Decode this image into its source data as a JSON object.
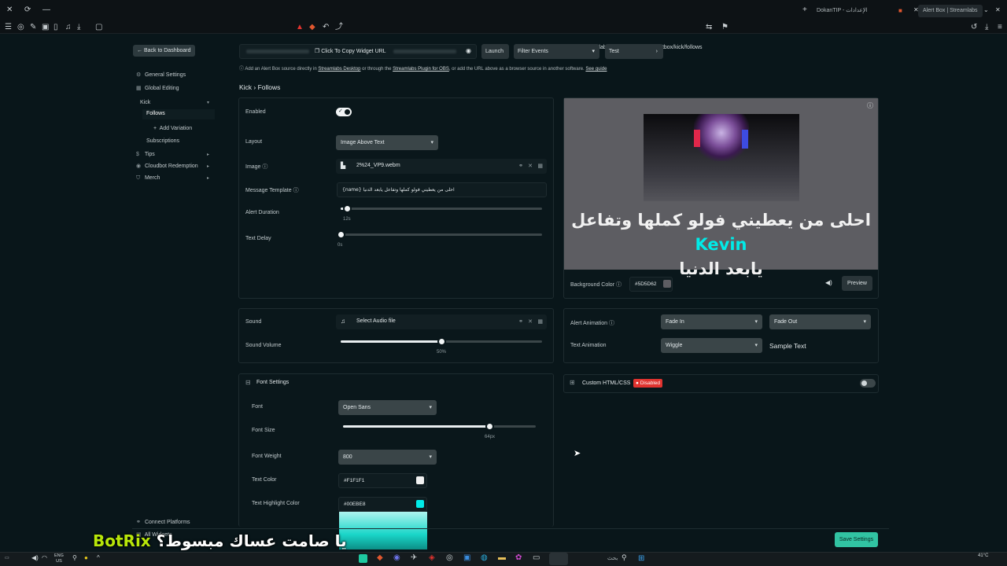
{
  "browser": {
    "tabs": [
      {
        "label": "DokanTIP - الإعدادات"
      },
      {
        "label": "Alert Box | Streamlabs"
      }
    ],
    "url": "streamlabs.com/dashboard#/alertbox/kick/follows"
  },
  "sidebar": {
    "back_label": "Back to Dashboard",
    "items": [
      {
        "label": "General Settings"
      },
      {
        "label": "Global Editing"
      },
      {
        "label": "Kick"
      },
      {
        "label": "Follows"
      },
      {
        "label": "Add Variation"
      },
      {
        "label": "Subscriptions"
      },
      {
        "label": "Tips"
      },
      {
        "label": "Cloudbot Redemption"
      },
      {
        "label": "Merch"
      }
    ],
    "bottom": [
      {
        "label": "Connect Platforms"
      },
      {
        "label": "All Widgets"
      }
    ]
  },
  "header": {
    "copy_url_label": "Click To Copy Widget URL",
    "launch_label": "Launch",
    "filter_label": "Filter Events",
    "test_label": "Test",
    "help_text_1": "Add an Alert Box source directly in",
    "help_link_1": "Streamlabs Desktop",
    "help_text_2": "or through the",
    "help_link_2": "Streamlabs Plugin for OBS",
    "help_text_3": ", or add the URL above as a browser source in another software.",
    "help_link_3": "See guide",
    "breadcrumb": "Kick › Follows"
  },
  "general": {
    "enabled_label": "Enabled",
    "enabled": true,
    "layout_label": "Layout",
    "layout_value": "Image Above Text",
    "image_label": "Image",
    "image_value": "2%24_VP9.webm",
    "message_label": "Message Template",
    "message_value": "{name} احلى من يعطيني فولو كملها وتفاعل يابعد الدنيا",
    "duration_label": "Alert Duration",
    "duration_value": "12s",
    "duration_fraction": 0.03,
    "delay_label": "Text Delay",
    "delay_value": "0s",
    "delay_fraction": 0.0
  },
  "preview": {
    "text_before": "احلى من يعطيني فولو كملها وتفاعل",
    "name": "Kevin",
    "text_after": "يابعد الدنيا",
    "bg_label": "Background Color",
    "bg_value": "#5D5D62",
    "bg_color": "#5D5D62",
    "preview_label": "Preview"
  },
  "sound": {
    "sound_label": "Sound",
    "sound_value": "Select Audio file",
    "volume_label": "Sound Volume",
    "volume_value": "50%",
    "volume_fraction": 0.5
  },
  "animation": {
    "alert_anim_label": "Alert Animation",
    "in_value": "Fade In",
    "out_value": "Fade Out",
    "text_anim_label": "Text Animation",
    "text_anim_value": "Wiggle",
    "sample_label": "Sample Text"
  },
  "custom": {
    "label": "Custom HTML/CSS",
    "badge": "Disabled"
  },
  "font": {
    "section_label": "Font Settings",
    "font_label": "Font",
    "font_value": "Open Sans",
    "size_label": "Font Size",
    "size_value": "64px",
    "size_fraction": 0.76,
    "weight_label": "Font Weight",
    "weight_value": "800",
    "color_label": "Text Color",
    "color_value": "#F1F1F1",
    "highlight_label": "Text Highlight Color",
    "highlight_value": "#00EBE8"
  },
  "save_label": "Save Settings",
  "overlay": {
    "brand": "BotRix",
    "text": "يا صامت عساك مبسوط؟"
  },
  "taskbar": {
    "search_placeholder": "بحث",
    "lang": "ENG",
    "region": "US",
    "temp": "41°C"
  },
  "colors": {
    "accent": "#31C3A2",
    "highlight": "#00EBE8",
    "disabled_red": "#E0332F"
  }
}
